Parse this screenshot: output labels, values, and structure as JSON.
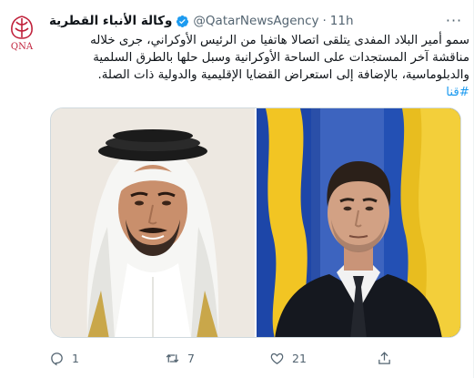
{
  "tweet": {
    "display_name": "وكالة الأنباء القطرية",
    "handle": "@QatarNewsAgency",
    "separator": "·",
    "time": "11h",
    "more_label": "···",
    "text_line1": "سمو أمير البلاد المفدى يتلقى اتصالا هاتفيا من الرئيس الأوكراني، جرى خلاله",
    "text_line2": "مناقشة آخر المستجدات على الساحة الأوكرانية وسبل حلها بالطرق السلمية",
    "text_line3": "والدبلوماسية، بالإضافة إلى استعراض القضايا الإقليمية والدولية ذات الصلة.",
    "hashtag": "#قنا",
    "logo_text": "QNA",
    "verified": true,
    "colors": {
      "accent": "#1d9bf0",
      "logo_red": "#c0203a",
      "muted": "#536471"
    }
  },
  "media": {
    "images": [
      {
        "subject": "man in white ghutra and black agal, beige background"
      },
      {
        "subject": "man in dark suit and tie in front of blue and yellow flags"
      }
    ]
  },
  "actions": {
    "reply_count": "1",
    "retweet_count": "7",
    "like_count": "21",
    "icons": [
      "reply-icon",
      "retweet-icon",
      "like-icon",
      "share-icon"
    ]
  }
}
